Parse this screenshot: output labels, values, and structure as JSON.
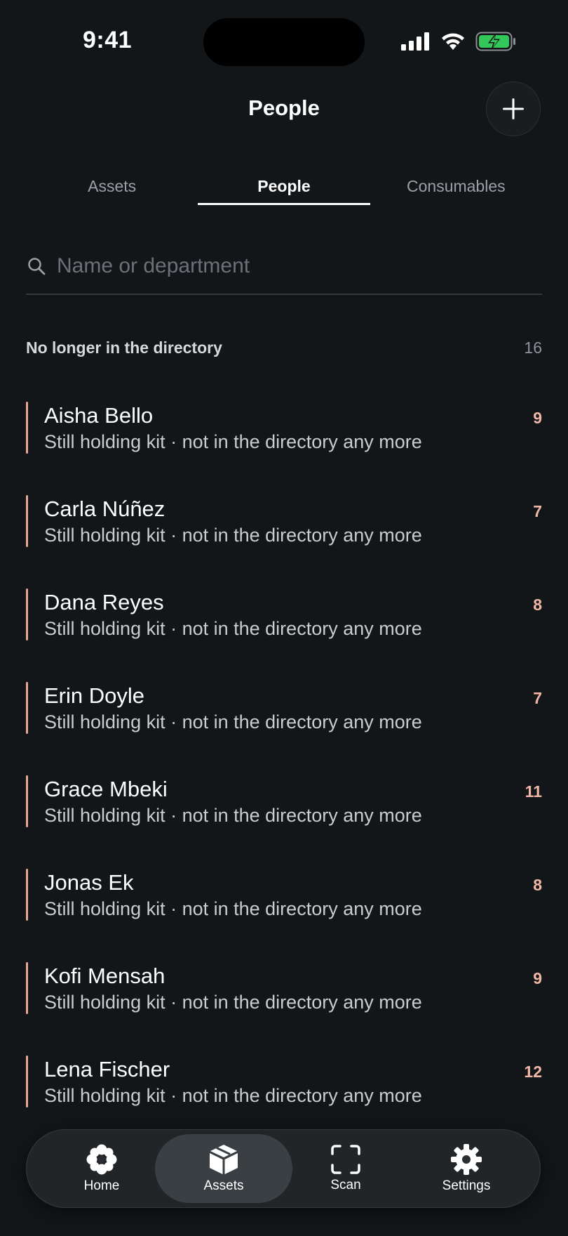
{
  "status_bar": {
    "time": "9:41"
  },
  "header": {
    "title": "People",
    "add_icon": "plus-icon"
  },
  "tabs": [
    {
      "label": "Assets",
      "active": false
    },
    {
      "label": "People",
      "active": true
    },
    {
      "label": "Consumables",
      "active": false
    }
  ],
  "search": {
    "placeholder": "Name or department",
    "value": ""
  },
  "section": {
    "title": "No longer in the directory",
    "count": "16"
  },
  "people": [
    {
      "name": "Aisha Bello",
      "subtitle": "Still holding kit · not in the directory any more",
      "count": "9"
    },
    {
      "name": "Carla Núñez",
      "subtitle": "Still holding kit · not in the directory any more",
      "count": "7"
    },
    {
      "name": "Dana Reyes",
      "subtitle": "Still holding kit · not in the directory any more",
      "count": "8"
    },
    {
      "name": "Erin Doyle",
      "subtitle": "Still holding kit · not in the directory any more",
      "count": "7"
    },
    {
      "name": "Grace Mbeki",
      "subtitle": "Still holding kit · not in the directory any more",
      "count": "11"
    },
    {
      "name": "Jonas Ek",
      "subtitle": "Still holding kit · not in the directory any more",
      "count": "8"
    },
    {
      "name": "Kofi Mensah",
      "subtitle": "Still holding kit · not in the directory any more",
      "count": "9"
    },
    {
      "name": "Lena Fischer",
      "subtitle": "Still holding kit · not in the directory any more",
      "count": "12"
    }
  ],
  "nav": [
    {
      "label": "Home",
      "icon": "flower-icon",
      "active": false
    },
    {
      "label": "Assets",
      "icon": "box-icon",
      "active": true
    },
    {
      "label": "Scan",
      "icon": "scan-frame-icon",
      "active": false
    },
    {
      "label": "Settings",
      "icon": "gear-icon",
      "active": false
    }
  ],
  "colors": {
    "background": "#131619",
    "accent_bar": "#e8a898",
    "count_text": "#f0b6a6",
    "battery": "#34c759"
  }
}
